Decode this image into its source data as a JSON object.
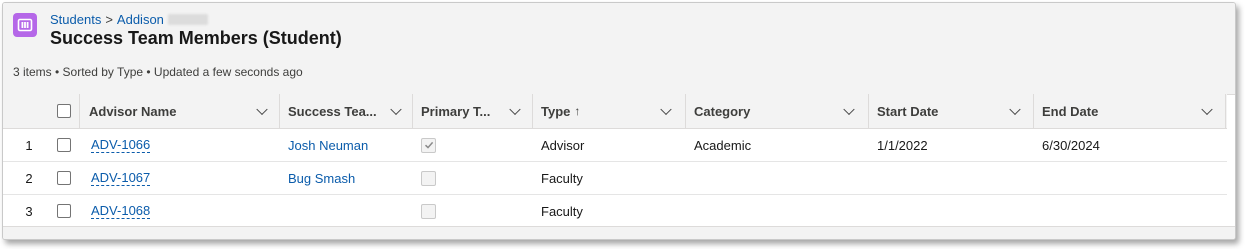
{
  "header": {
    "breadcrumb": {
      "parent": "Students",
      "separator": ">",
      "current": "Addison"
    },
    "title": "Success Team Members (Student)",
    "list_info": "3 items • Sorted by Type • Updated a few seconds ago"
  },
  "table": {
    "columns": [
      {
        "label": "Advisor Name"
      },
      {
        "label": "Success Tea..."
      },
      {
        "label": "Primary T..."
      },
      {
        "label": "Type"
      },
      {
        "label": "Category"
      },
      {
        "label": "Start Date"
      },
      {
        "label": "End Date"
      }
    ],
    "sort_indicator": "↑",
    "rows": [
      {
        "num": "1",
        "advisor_name": "ADV-1066",
        "success_team": "Josh Neuman",
        "primary": true,
        "type": "Advisor",
        "category": "Academic",
        "start_date": "1/1/2022",
        "end_date": "6/30/2024"
      },
      {
        "num": "2",
        "advisor_name": "ADV-1067",
        "success_team": "Bug Smash",
        "primary": false,
        "type": "Faculty",
        "category": "",
        "start_date": "",
        "end_date": ""
      },
      {
        "num": "3",
        "advisor_name": "ADV-1068",
        "success_team": "",
        "primary": false,
        "type": "Faculty",
        "category": "",
        "start_date": "",
        "end_date": ""
      }
    ]
  },
  "colors": {
    "accent_link": "#0b5cab",
    "app_icon": "#b567e8",
    "header_bg": "#f3f3f3"
  }
}
